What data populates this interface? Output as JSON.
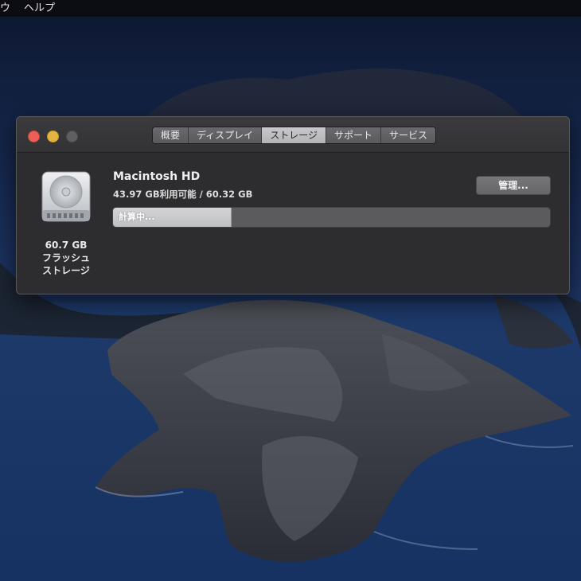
{
  "menubar": {
    "items": [
      "ウ",
      "ヘルプ"
    ]
  },
  "window": {
    "tabs": [
      {
        "label": "概要",
        "active": false
      },
      {
        "label": "ディスプレイ",
        "active": false
      },
      {
        "label": "ストレージ",
        "active": true
      },
      {
        "label": "サポート",
        "active": false
      },
      {
        "label": "サービス",
        "active": false
      }
    ],
    "drive": {
      "icon": "internal-drive-icon",
      "size": "60.7 GB",
      "type_line1": "フラッシュ",
      "type_line2": "ストレージ"
    },
    "volume": {
      "name": "Macintosh HD",
      "detail": "43.97 GB利用可能 / 60.32 GB",
      "manage_label": "管理...",
      "bar_label": "計算中...",
      "bar_fill_fraction": 0.27
    }
  },
  "colors": {
    "close": "#ec5f57",
    "minimize": "#e3b440",
    "zoom_disabled": "#5f5e61",
    "active_tab": "#c0c0c2"
  }
}
